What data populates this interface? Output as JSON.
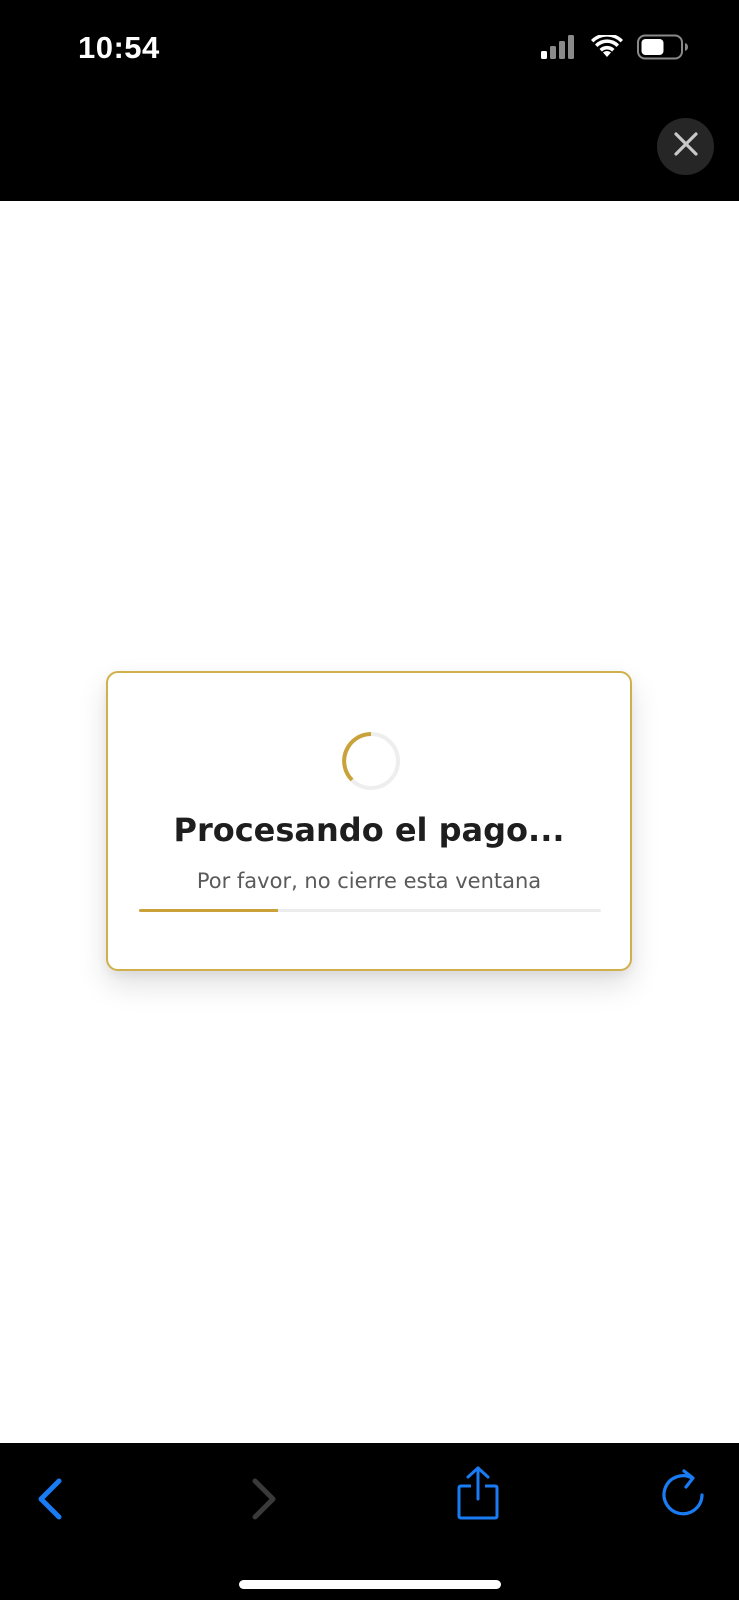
{
  "status_bar": {
    "time": "10:54",
    "icons": [
      "cellular-signal-icon",
      "wifi-icon",
      "battery-icon"
    ]
  },
  "header": {
    "close_icon": "close-icon"
  },
  "modal": {
    "title": "Procesando el pago...",
    "subtitle": "Por favor, no cierre esta ventana",
    "progress": 0.3,
    "accent_color": "#c9a23a"
  },
  "toolbar": {
    "items": [
      "back-icon",
      "forward-icon",
      "share-icon",
      "reload-icon"
    ],
    "active_color": "#1a7cf5",
    "disabled_color": "#3a3a3a"
  }
}
